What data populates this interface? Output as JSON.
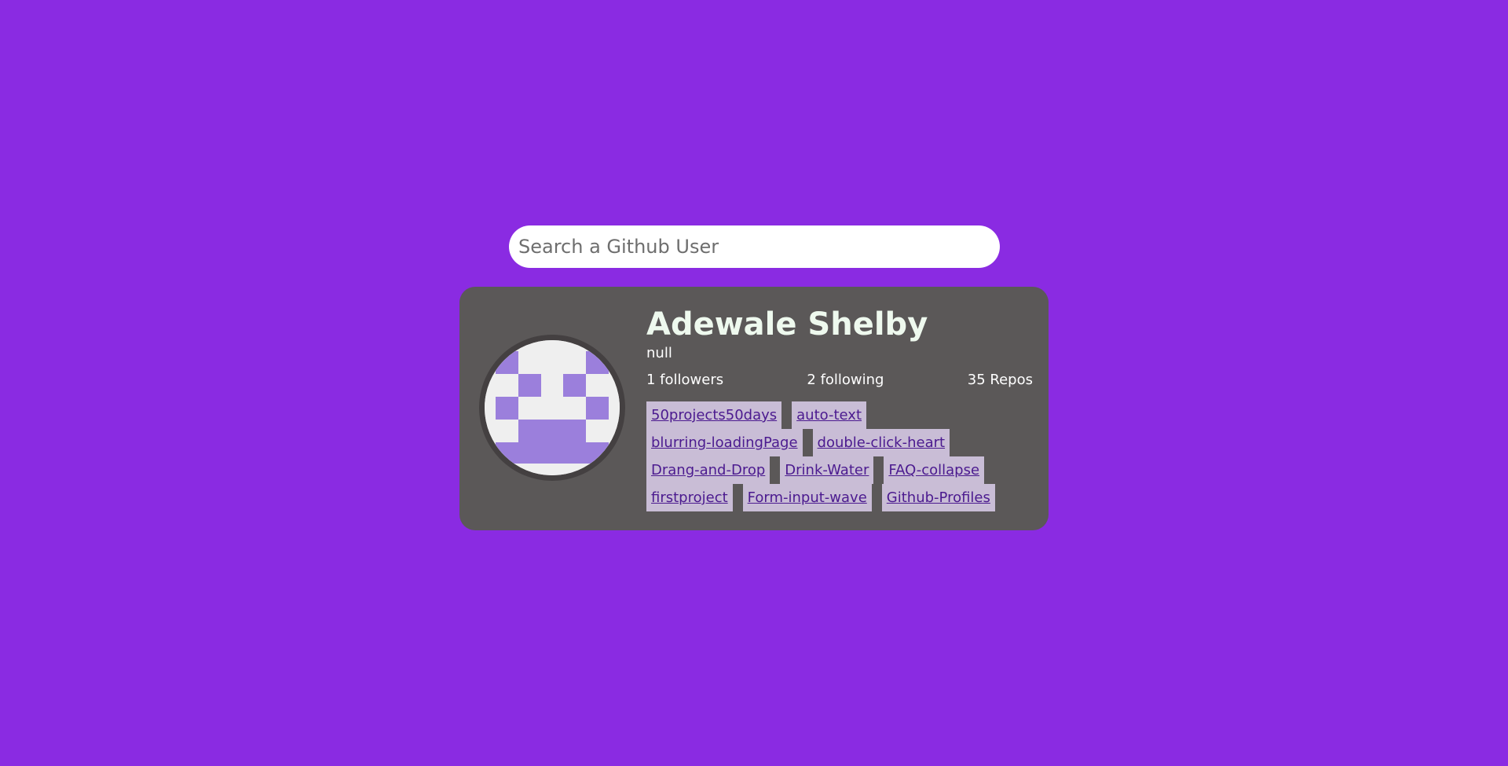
{
  "search": {
    "placeholder": "Search a Github User"
  },
  "profile": {
    "name": "Adewale Shelby",
    "bio": "null",
    "followers": "1 followers",
    "following": "2 following",
    "repos": "35 Repos",
    "avatar_icon": "identicon-avatar"
  },
  "repo_links": [
    "50projects50days",
    "auto-text",
    "blurring-loadingPage",
    "double-click-heart",
    "Drang-and-Drop",
    "Drink-Water",
    "FAQ-collapse",
    "firstproject",
    "Form-input-wave",
    "Github-Profiles"
  ],
  "colors": {
    "background": "#8a2be2",
    "card": "#5b5858",
    "repo_chip": "#c9bdd6",
    "repo_text": "#4b1a8f",
    "identicon": "#9b7fdc"
  }
}
